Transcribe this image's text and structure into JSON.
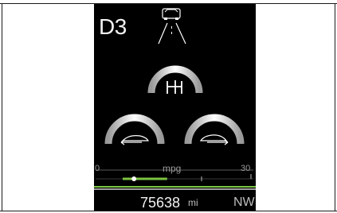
{
  "cluster": {
    "gear_indicator": "D3",
    "icons": {
      "lane_assist": "car-with-lane-lines-icon",
      "manual_shift": "manual-gear-shift-icon",
      "left_gauge": "car-rear-arrow-icon",
      "right_gauge": "car-front-arrow-icon"
    },
    "fuel_economy": {
      "min_label": "0",
      "unit_label": "mpg",
      "max_label": "30",
      "bar_fill_level": 0.55,
      "marker_level": 0.35
    },
    "odometer": {
      "value": "75638",
      "unit": "mi"
    },
    "compass_heading": "NW",
    "colors": {
      "background": "#000000",
      "text": "#f2f2f2",
      "accent_green": "#7bc442"
    }
  }
}
